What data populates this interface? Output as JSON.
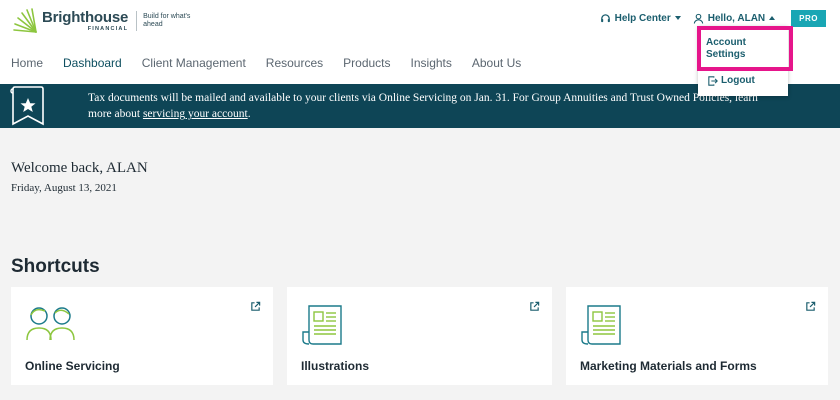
{
  "brand": {
    "name": "Brighthouse",
    "sub": "FINANCIAL",
    "tagline": "Build for what's ahead"
  },
  "utility": {
    "help_center": "Help Center",
    "greeting": "Hello, ALAN",
    "badge": "PRO"
  },
  "nav": {
    "items": [
      {
        "label": "Home"
      },
      {
        "label": "Dashboard"
      },
      {
        "label": "Client Management"
      },
      {
        "label": "Resources"
      },
      {
        "label": "Products"
      },
      {
        "label": "Insights"
      },
      {
        "label": "About Us"
      }
    ],
    "active": "Dashboard"
  },
  "banner": {
    "text_before": "Tax documents will be mailed and available to your clients via Online Servicing on Jan. 31. For Group Annuities and Trust Owned Policies, learn more about ",
    "link": "servicing your account",
    "text_after": "."
  },
  "welcome": {
    "heading": "Welcome back, ALAN",
    "date": "Friday, August 13, 2021"
  },
  "shortcuts": {
    "title": "Shortcuts",
    "cards": [
      {
        "label": "Online Servicing",
        "icon": "people-icon"
      },
      {
        "label": "Illustrations",
        "icon": "document-icon"
      },
      {
        "label": "Marketing Materials and Forms",
        "icon": "document-icon"
      }
    ]
  },
  "dropdown": {
    "account_settings": "Account Settings",
    "logout": "Logout"
  },
  "colors": {
    "banner_bg": "#0e4556",
    "accent_teal": "#1b5e6e",
    "pro_badge": "#19a6b4",
    "icon_green": "#8dc63f",
    "highlight": "#e6158b"
  }
}
